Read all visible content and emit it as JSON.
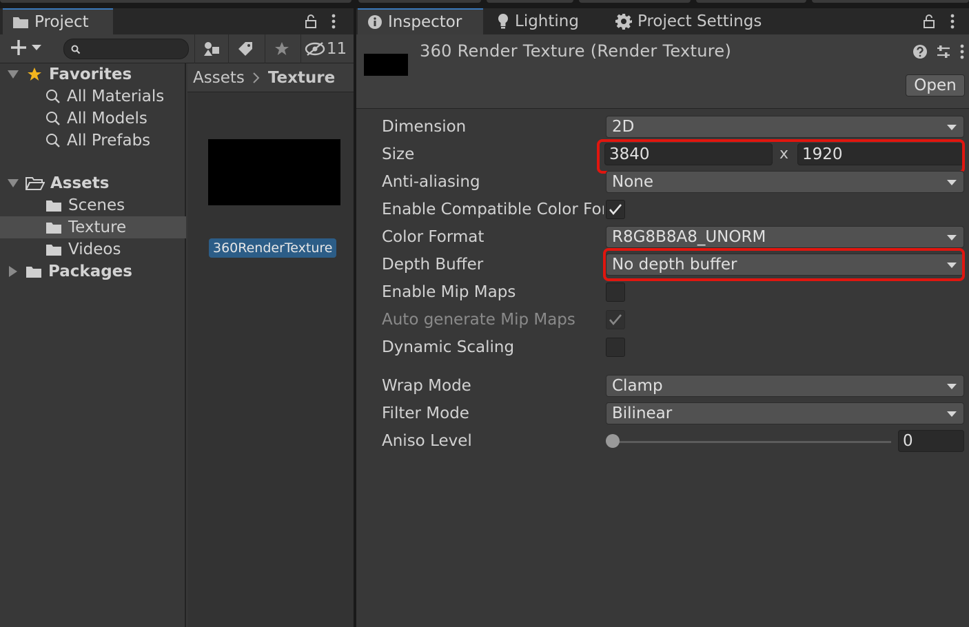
{
  "project_panel": {
    "tab_label": "Project",
    "hidden_count": "11",
    "favorites": {
      "label": "Favorites",
      "items": [
        "All Materials",
        "All Models",
        "All Prefabs"
      ]
    },
    "assets": {
      "label": "Assets",
      "items": [
        "Scenes",
        "Texture",
        "Videos"
      ],
      "selected": "Texture"
    },
    "packages_label": "Packages",
    "breadcrumb": {
      "root": "Assets",
      "current": "Texture"
    },
    "file": {
      "name": "360RenderTexture"
    }
  },
  "inspector": {
    "tabs": [
      "Inspector",
      "Lighting",
      "Project Settings"
    ],
    "asset_title": "360 Render Texture (Render Texture)",
    "open_label": "Open",
    "fields": {
      "dimension": {
        "label": "Dimension",
        "value": "2D"
      },
      "size": {
        "label": "Size",
        "width": "3840",
        "sep": "x",
        "height": "1920"
      },
      "anti_aliasing": {
        "label": "Anti-aliasing",
        "value": "None"
      },
      "compatible_color": {
        "label": "Enable Compatible Color Format",
        "checked": true
      },
      "color_format": {
        "label": "Color Format",
        "value": "R8G8B8A8_UNORM"
      },
      "depth_buffer": {
        "label": "Depth Buffer",
        "value": "No depth buffer"
      },
      "mip_maps": {
        "label": "Enable Mip Maps",
        "checked": false
      },
      "auto_mip": {
        "label": "Auto generate Mip Maps",
        "checked": true,
        "disabled": true
      },
      "dynamic_scaling": {
        "label": "Dynamic Scaling",
        "checked": false
      },
      "wrap_mode": {
        "label": "Wrap Mode",
        "value": "Clamp"
      },
      "filter_mode": {
        "label": "Filter Mode",
        "value": "Bilinear"
      },
      "aniso_level": {
        "label": "Aniso Level",
        "value": "0"
      }
    }
  },
  "colors": {
    "highlight": "#e0160f",
    "selection": "#2c5d87",
    "favorite_star": "#f2b51e"
  },
  "icons": [
    "folder-icon",
    "lock-icon",
    "kebab-menu-icon",
    "plus-icon",
    "search-icon",
    "filter-type-icon",
    "label-icon",
    "star-icon",
    "hidden-eye-icon",
    "info-icon",
    "lightbulb-icon",
    "gear-icon",
    "help-icon",
    "presets-icon",
    "checkmark-icon"
  ]
}
